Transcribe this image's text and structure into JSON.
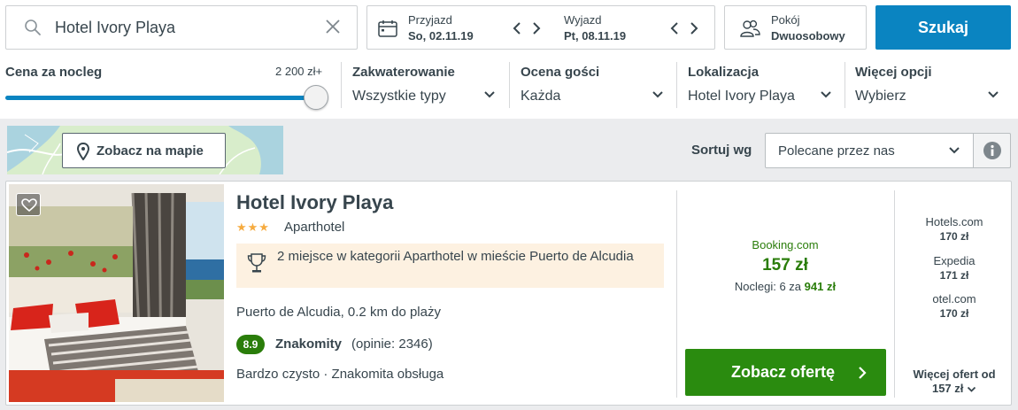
{
  "search": {
    "value": "Hotel Ivory Playa"
  },
  "dates": {
    "checkin_label": "Przyjazd",
    "checkin_value": "So, 02.11.19",
    "checkout_label": "Wyjazd",
    "checkout_value": "Pt, 08.11.19"
  },
  "room": {
    "label": "Pokój",
    "value": "Dwuosobowy"
  },
  "search_button": "Szukaj",
  "filters": {
    "price_title": "Cena za nocleg",
    "price_max": "2 200 zł+",
    "price_slider_fraction": 1.0,
    "accommodation_title": "Zakwaterowanie",
    "accommodation_value": "Wszystkie typy",
    "rating_title": "Ocena gości",
    "rating_value": "Każda",
    "location_title": "Lokalizacja",
    "location_value": "Hotel Ivory Playa",
    "more_title": "Więcej opcji",
    "more_value": "Wybierz"
  },
  "map_button": "Zobacz na mapie",
  "sort": {
    "label": "Sortuj wg",
    "value": "Polecane przez nas"
  },
  "hotel": {
    "name": "Hotel Ivory Playa",
    "stars": "★★★",
    "star_count": 3,
    "type": "Aparthotel",
    "award": "2 miejsce w kategorii Aparthotel w mieście Puerto de Alcudia",
    "location": "Puerto de Alcudia, 0.2 km do plaży",
    "rating": "8.9",
    "rating_word": "Znakomity",
    "rating_count": "(opinie: 2346)",
    "highlights": "Bardzo czysto · Znakomita obsługa"
  },
  "best_offer": {
    "site": "Booking.com",
    "price": "157 zł",
    "nights_label": "Noclegi: 6 za",
    "total": "941 zł",
    "button": "Zobacz ofertę"
  },
  "alt_offers": [
    {
      "site": "Hotels.com",
      "price": "170 zł"
    },
    {
      "site": "Expedia",
      "price": "171 zł"
    },
    {
      "site": "otel.com",
      "price": "170 zł"
    }
  ],
  "more_offers": {
    "line1": "Więcej ofert od",
    "line2": "157 zł"
  },
  "colors": {
    "accent_blue": "#0a84c1",
    "deal_green": "#2a8b0f",
    "rating_green": "#2a7d0a",
    "star_yellow": "#f6ab3f",
    "award_bg": "#fdf1e1"
  }
}
